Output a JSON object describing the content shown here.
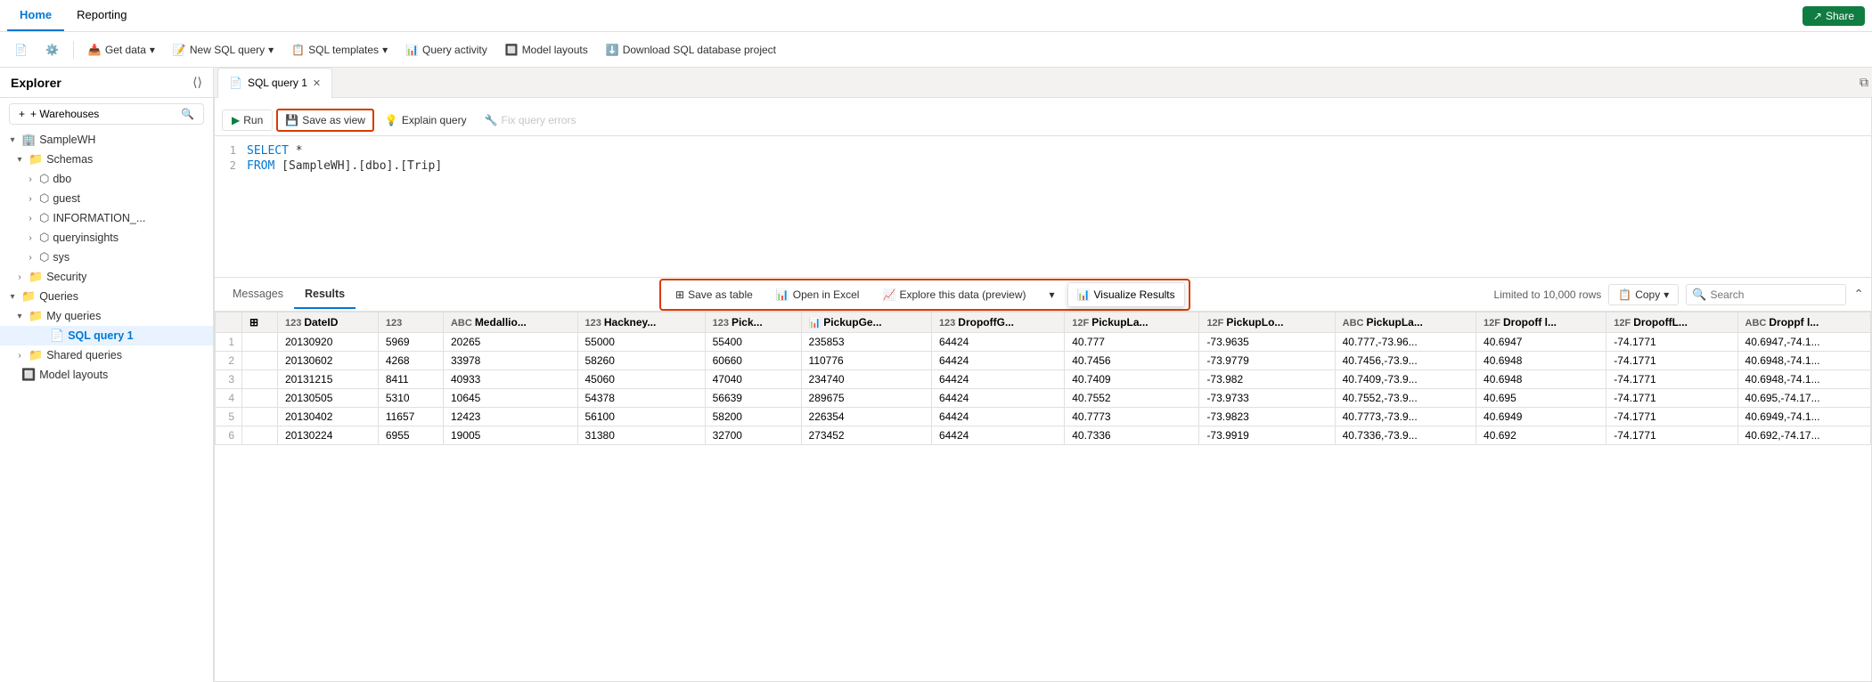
{
  "topNav": {
    "tabs": [
      {
        "label": "Home",
        "active": true
      },
      {
        "label": "Reporting",
        "active": false
      }
    ],
    "shareBtn": "Share"
  },
  "toolbar": {
    "buttons": [
      {
        "label": "",
        "icon": "📄",
        "name": "new-icon"
      },
      {
        "label": "",
        "icon": "⚙️",
        "name": "settings-icon"
      },
      {
        "label": "Get data",
        "icon": "📥",
        "name": "get-data-btn",
        "hasDropdown": true
      },
      {
        "label": "New SQL query",
        "icon": "📝",
        "name": "new-sql-btn",
        "hasDropdown": true
      },
      {
        "label": "SQL templates",
        "icon": "📋",
        "name": "sql-templates-btn",
        "hasDropdown": true
      },
      {
        "label": "Query activity",
        "icon": "📊",
        "name": "query-activity-btn"
      },
      {
        "label": "Model layouts",
        "icon": "🔲",
        "name": "model-layouts-btn"
      },
      {
        "label": "Download SQL database project",
        "icon": "⬇️",
        "name": "download-btn"
      }
    ]
  },
  "sidebar": {
    "title": "Explorer",
    "addWarehouseLabel": "+ Warehouses",
    "tree": [
      {
        "label": "SampleWH",
        "type": "warehouse",
        "indent": 0,
        "expanded": true,
        "icon": "▾"
      },
      {
        "label": "Schemas",
        "type": "folder",
        "indent": 1,
        "expanded": true,
        "icon": "▾"
      },
      {
        "label": "dbo",
        "type": "schema",
        "indent": 2,
        "expanded": false,
        "icon": "›"
      },
      {
        "label": "guest",
        "type": "schema",
        "indent": 2,
        "expanded": false,
        "icon": "›"
      },
      {
        "label": "INFORMATION_...",
        "type": "schema",
        "indent": 2,
        "expanded": false,
        "icon": "›"
      },
      {
        "label": "queryinsights",
        "type": "schema",
        "indent": 2,
        "expanded": false,
        "icon": "›"
      },
      {
        "label": "sys",
        "type": "schema",
        "indent": 2,
        "expanded": false,
        "icon": "›"
      },
      {
        "label": "Security",
        "type": "folder",
        "indent": 1,
        "expanded": false,
        "icon": "›"
      },
      {
        "label": "Queries",
        "type": "folder",
        "indent": 0,
        "expanded": true,
        "icon": "▾"
      },
      {
        "label": "My queries",
        "type": "folder",
        "indent": 1,
        "expanded": true,
        "icon": "▾"
      },
      {
        "label": "SQL query 1",
        "type": "query",
        "indent": 2,
        "expanded": false,
        "icon": "",
        "active": true
      },
      {
        "label": "Shared queries",
        "type": "folder",
        "indent": 1,
        "expanded": false,
        "icon": "›"
      },
      {
        "label": "Model layouts",
        "type": "section",
        "indent": 0,
        "expanded": false,
        "icon": ""
      }
    ]
  },
  "editorTab": {
    "label": "SQL query 1",
    "icon": "📄"
  },
  "sqlToolbar": {
    "runLabel": "Run",
    "saveAsViewLabel": "Save as view",
    "explainQueryLabel": "Explain query",
    "fixQueryErrorsLabel": "Fix query errors"
  },
  "codeLines": [
    {
      "num": "1",
      "tokens": [
        {
          "text": "SELECT ",
          "cls": "kw-select"
        },
        {
          "text": "*",
          "cls": "code-default"
        }
      ]
    },
    {
      "num": "2",
      "tokens": [
        {
          "text": "FROM ",
          "cls": "kw-from"
        },
        {
          "text": "[SampleWH].[dbo].[Trip]",
          "cls": "code-default"
        }
      ]
    }
  ],
  "resultsTabs": [
    {
      "label": "Messages",
      "active": false
    },
    {
      "label": "Results",
      "active": true
    }
  ],
  "resultsActions": {
    "saveAsTable": "Save as table",
    "openInExcel": "Open in Excel",
    "exploreData": "Explore this data (preview)",
    "visualizeResults": "Visualize Results",
    "rowLimit": "Limited to 10,000 rows",
    "copy": "Copy",
    "searchPlaceholder": "Search"
  },
  "tableHeaders": [
    {
      "label": "",
      "type": "row-num"
    },
    {
      "label": "🔲",
      "type": "icon-only"
    },
    {
      "label": "123 DateID",
      "type": "num"
    },
    {
      "label": "123",
      "type": "num"
    },
    {
      "label": "Medallio...",
      "type": "text"
    },
    {
      "label": "123 Hackney...",
      "type": "num"
    },
    {
      "label": "123 Pick...",
      "type": "num"
    },
    {
      "label": "PickupGe...",
      "type": "chart"
    },
    {
      "label": "123 DropoffG...",
      "type": "num"
    },
    {
      "label": "12F PickupLa...",
      "type": "float"
    },
    {
      "label": "12F PickupLo...",
      "type": "float"
    },
    {
      "label": "ABC PickupLa...",
      "type": "text"
    },
    {
      "label": "12F Dropoff l...",
      "type": "float"
    },
    {
      "label": "12F DropoffL...",
      "type": "float"
    },
    {
      "label": "ABC Droppf l...",
      "type": "text"
    }
  ],
  "tableRows": [
    [
      1,
      "",
      "20130920",
      "5969",
      "20265",
      "55000",
      "55400",
      "235853",
      "64424",
      "40.777",
      "-73.9635",
      "40.777,-73.96...",
      "40.6947",
      "-74.1771",
      "40.6947,-74.1..."
    ],
    [
      2,
      "",
      "20130602",
      "4268",
      "33978",
      "58260",
      "60660",
      "110776",
      "64424",
      "40.7456",
      "-73.9779",
      "40.7456,-73.9...",
      "40.6948",
      "-74.1771",
      "40.6948,-74.1..."
    ],
    [
      3,
      "",
      "20131215",
      "8411",
      "40933",
      "45060",
      "47040",
      "234740",
      "64424",
      "40.7409",
      "-73.982",
      "40.7409,-73.9...",
      "40.6948",
      "-74.1771",
      "40.6948,-74.1..."
    ],
    [
      4,
      "",
      "20130505",
      "5310",
      "10645",
      "54378",
      "56639",
      "289675",
      "64424",
      "40.7552",
      "-73.9733",
      "40.7552,-73.9...",
      "40.695",
      "-74.1771",
      "40.695,-74.17..."
    ],
    [
      5,
      "",
      "20130402",
      "11657",
      "12423",
      "56100",
      "58200",
      "226354",
      "64424",
      "40.7773",
      "-73.9823",
      "40.7773,-73.9...",
      "40.6949",
      "-74.1771",
      "40.6949,-74.1..."
    ],
    [
      6,
      "",
      "20130224",
      "6955",
      "19005",
      "31380",
      "32700",
      "273452",
      "64424",
      "40.7336",
      "-73.9919",
      "40.7336,-73.9...",
      "40.692",
      "-74.1771",
      "40.692,-74.17..."
    ]
  ]
}
